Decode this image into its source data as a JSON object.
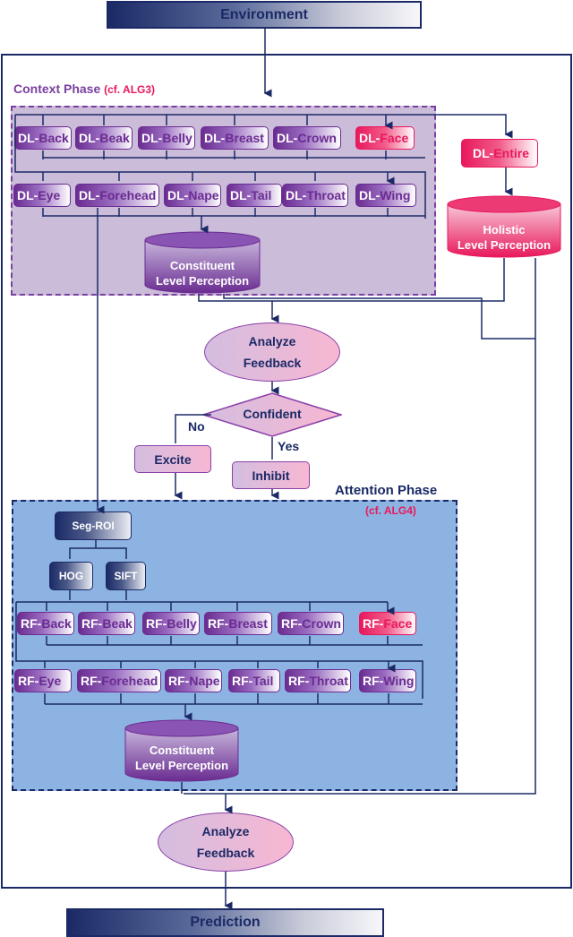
{
  "io": {
    "environment": "Environment",
    "prediction": "Prediction"
  },
  "context_phase": {
    "title": "Context Phase",
    "ref": "(cf. ALG3)"
  },
  "attention_phase": {
    "title": "Attention Phase",
    "ref": "(cf. ALG4)"
  },
  "dl_row1": [
    {
      "prefix": "DL-",
      "suffix": "Back"
    },
    {
      "prefix": "DL-",
      "suffix": "Beak"
    },
    {
      "prefix": "DL-",
      "suffix": "Belly"
    },
    {
      "prefix": "DL-",
      "suffix": "Breast"
    },
    {
      "prefix": "DL-",
      "suffix": "Crown"
    },
    {
      "prefix": "DL-",
      "suffix": "Face"
    }
  ],
  "dl_row2": [
    {
      "prefix": "DL-",
      "suffix": "Eye"
    },
    {
      "prefix": "DL-",
      "suffix": "Forehead"
    },
    {
      "prefix": "DL-",
      "suffix": "Nape"
    },
    {
      "prefix": "DL-",
      "suffix": "Tail"
    },
    {
      "prefix": "DL-",
      "suffix": "Throat"
    },
    {
      "prefix": "DL-",
      "suffix": "Wing"
    }
  ],
  "dl_entire": {
    "prefix": "DL-",
    "suffix": "Entire"
  },
  "constituent_1": {
    "line1": "Constituent",
    "line2": "Level Perception"
  },
  "holistic": {
    "line1": "Holistic",
    "line2": "Level Perception"
  },
  "analyze_1": {
    "line1": "Analyze",
    "line2": "Feedback"
  },
  "decision": {
    "label": "Confident",
    "no": "No",
    "yes": "Yes"
  },
  "excite": "Excite",
  "inhibit": "Inhibit",
  "seg_roi": "Seg-ROI",
  "hog": "HOG",
  "sift": "SIFT",
  "rf_row1": [
    {
      "prefix": "RF-",
      "suffix": "Back"
    },
    {
      "prefix": "RF-",
      "suffix": "Beak"
    },
    {
      "prefix": "RF-",
      "suffix": "Belly"
    },
    {
      "prefix": "RF-",
      "suffix": "Breast"
    },
    {
      "prefix": "RF-",
      "suffix": "Crown"
    },
    {
      "prefix": "RF-",
      "suffix": "Face"
    }
  ],
  "rf_row2": [
    {
      "prefix": "RF-",
      "suffix": "Eye"
    },
    {
      "prefix": "RF-",
      "suffix": "Forehead"
    },
    {
      "prefix": "RF-",
      "suffix": "Nape"
    },
    {
      "prefix": "RF-",
      "suffix": "Tail"
    },
    {
      "prefix": "RF-",
      "suffix": "Throat"
    },
    {
      "prefix": "RF-",
      "suffix": "Wing"
    }
  ],
  "constituent_2": {
    "line1": "Constituent",
    "line2": "Level Perception"
  },
  "analyze_2": {
    "line1": "Analyze",
    "line2": "Feedback"
  },
  "colors": {
    "navy": "#1b2a66",
    "purple": "#6a2c91",
    "pink": "#e8185c",
    "context_bg": "#cbbcd9",
    "attention_bg": "#8db3e2"
  }
}
